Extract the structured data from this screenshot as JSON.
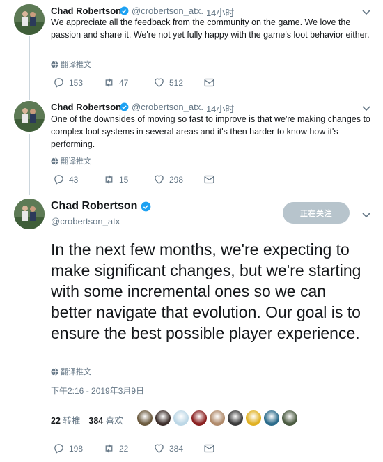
{
  "colors": {
    "text": "#14171a",
    "muted": "#657786",
    "verified": "#1da1f2",
    "follow_bg": "#b7c4cc",
    "line": "#ccd6dd"
  },
  "tweets": [
    {
      "name": "Chad Robertson",
      "handle": "@crobertson_atx",
      "time": "· 14小时",
      "text": "We appreciate all the feedback from the community on the game. We love the passion and share it. We're not yet fully happy with the game's loot behavior either.",
      "translate": "翻译推文",
      "replies": "153",
      "retweets": "47",
      "likes": "512"
    },
    {
      "name": "Chad Robertson",
      "handle": "@crobertson_atx",
      "time": "· 14小时",
      "text": "One of the downsides of moving so fast to improve is that we're making changes to complex loot systems in several areas and it's then harder to know how it's performing.",
      "translate": "翻译推文",
      "replies": "43",
      "retweets": "15",
      "likes": "298"
    }
  ],
  "main": {
    "name": "Chad Robertson",
    "handle": "@crobertson_atx",
    "follow_label": "正在关注",
    "text": "In the next few months, we're expecting to make significant changes, but we're starting with some incremental ones so we can better navigate that evolution. Our goal is to ensure the best possible player experience.",
    "translate": "翻译推文",
    "timestamp": "下午2:16 - 2019年3月9日",
    "retweet_count": "22",
    "retweet_label": "转推",
    "like_count": "384",
    "like_label": "喜欢",
    "replies": "198",
    "retweets": "22",
    "likes": "384",
    "liker_colors": [
      "#6b5a3e",
      "#3d2f2b",
      "#bcd7e6",
      "#8a2020",
      "#b08a6a",
      "#3a3a3a",
      "#e0b020",
      "#2a6a8a",
      "#4a5a40"
    ]
  }
}
